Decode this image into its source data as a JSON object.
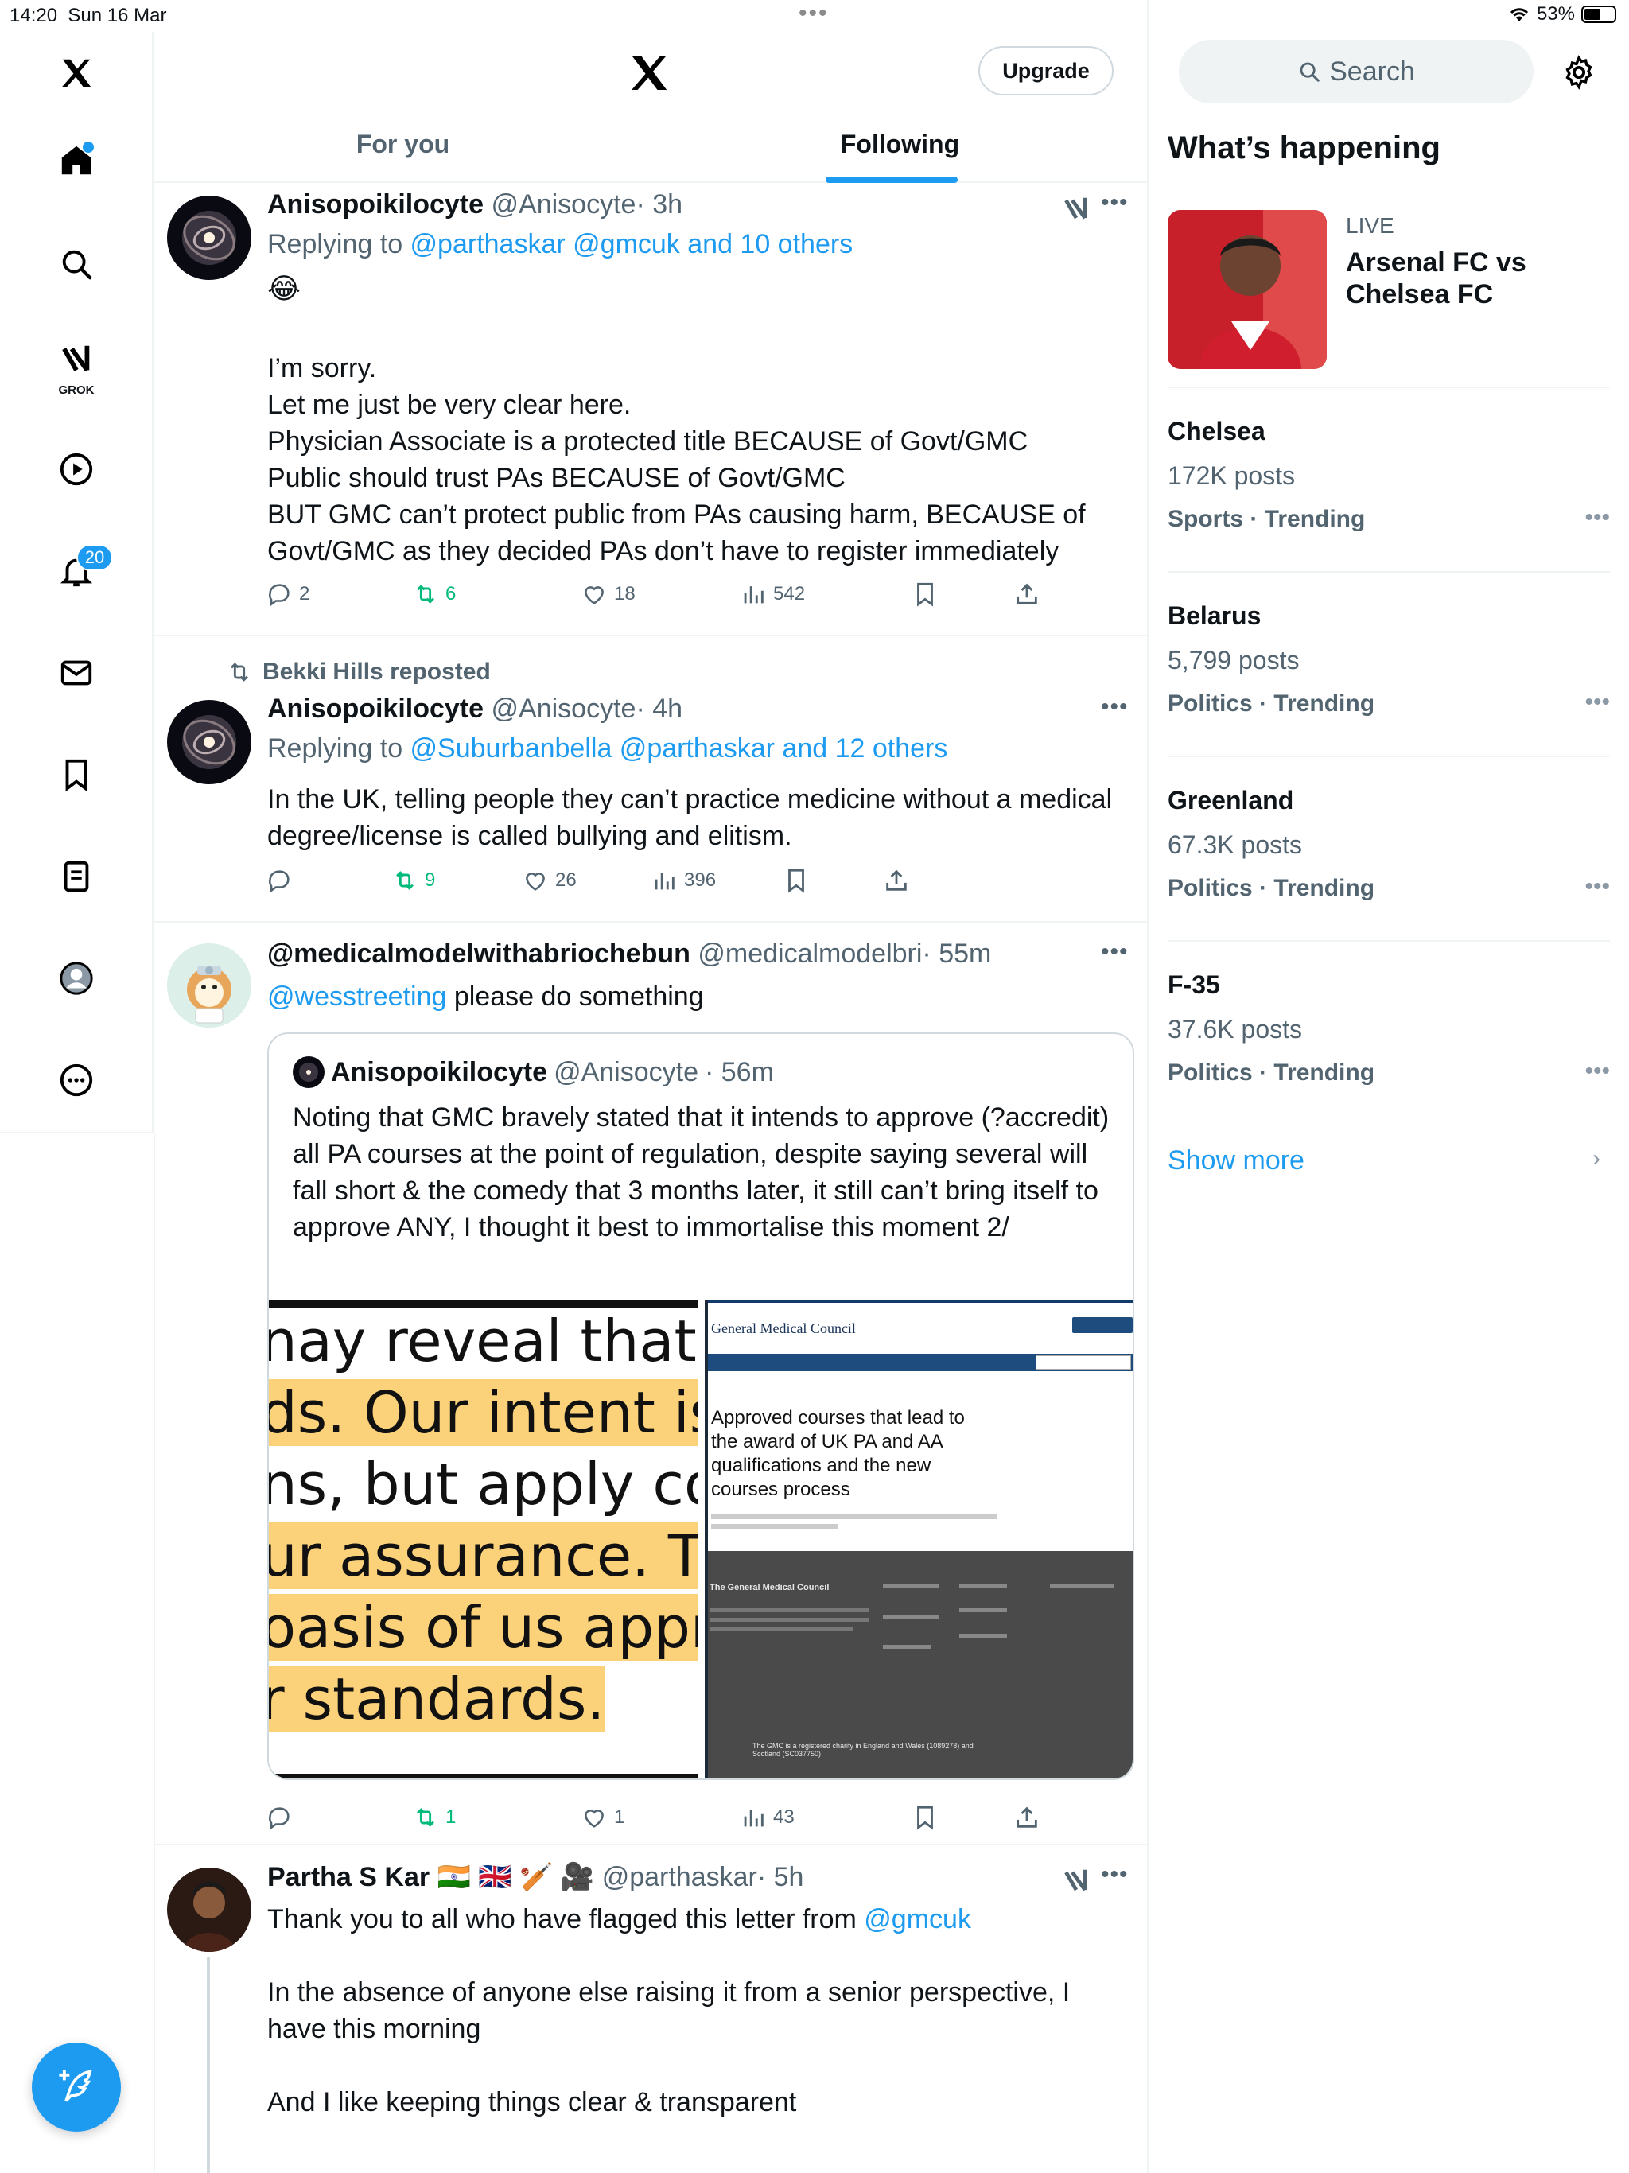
{
  "status_bar": {
    "time": "14:20",
    "date": "Sun 16 Mar",
    "battery": "53%"
  },
  "nav": {
    "grok_label": "GROK",
    "notifications_count": "20"
  },
  "header": {
    "upgrade_label": "Upgrade",
    "tabs": [
      {
        "label": "For you"
      },
      {
        "label": "Following"
      }
    ]
  },
  "tweets": [
    {
      "name": "Anisopoikilocyte",
      "handle": "@Anisocyte",
      "time": "· 3h",
      "reply_prefix": "Replying to ",
      "reply_targets": "@parthaskar @gmcuk and 10 others",
      "emoji": "😂",
      "text": "I’m sorry.\nLet me just be very clear here.\nPhysician Associate is a protected title BECAUSE of Govt/GMC\nPublic should trust PAs BECAUSE of Govt/GMC\nBUT GMC can’t protect public from PAs causing harm, BECAUSE of Govt/GMC as they decided PAs don’t have to register immediately",
      "replies": "2",
      "reposts": "6",
      "likes": "18",
      "views": "542"
    },
    {
      "repost_by": "Bekki Hills reposted",
      "name": "Anisopoikilocyte",
      "handle": "@Anisocyte",
      "time": "· 4h",
      "reply_prefix": "Replying to ",
      "reply_targets": "@Suburbanbella @parthaskar and 12 others",
      "text": "In the UK, telling people they can’t practice medicine without a medical degree/license is called bullying and elitism.",
      "replies": "",
      "reposts": "9",
      "likes": "26",
      "views": "396"
    },
    {
      "name": "@medicalmodelwithabriochebun",
      "handle": "@medicalmodelbri",
      "time": "· 55m",
      "mention": "@wesstreeting",
      "text": " please do something",
      "quote": {
        "name": "Anisopoikilocyte",
        "handle": "@Anisocyte",
        "time": "· 56m",
        "text": "Noting that GMC bravely stated that it intends to approve (?accredit) all PA courses at the point of regulation, despite saying several will fall short & the comedy that 3 months later, it still can’t bring itself to approve ANY, I thought it best to immortalise this moment 2/",
        "image_left_lines": [
          "nay reveal that PA",
          "ds. Our intent is to",
          "ns, but apply cond",
          "ur assurance. The",
          "oasis of us approv",
          "r standards."
        ],
        "gmc_site_title": "General Medical Council",
        "gmc_heading": "Approved courses that lead to the award of UK PA and AA qualifications and the new courses process",
        "gmc_footer_org": "The General Medical Council",
        "gmc_footer_charity": "The GMC is a registered charity in England and Wales (1089278) and Scotland (SC037750)"
      },
      "replies": "",
      "reposts": "1",
      "likes": "1",
      "views": "43"
    },
    {
      "name": "Partha S Kar",
      "flags": "🇮🇳 🇬🇧 🏏 🎥",
      "handle": "@parthaskar",
      "time": "· 5h",
      "text_prefix": "Thank you to all who have flagged this letter from ",
      "mention": "@gmcuk",
      "text": "In the absence of anyone else raising it from a senior perspective, I have this morning\n\nAnd I like keeping things clear & transparent"
    }
  ],
  "sidebar": {
    "search_placeholder": "Search",
    "whats_happening": "What’s happening",
    "live": {
      "tag": "LIVE",
      "title": "Arsenal FC vs Chelsea FC"
    },
    "trends": [
      {
        "name": "Chelsea",
        "posts": "172K posts",
        "category": "Sports · Trending"
      },
      {
        "name": "Belarus",
        "posts": "5,799 posts",
        "category": "Politics · Trending"
      },
      {
        "name": "Greenland",
        "posts": "67.3K posts",
        "category": "Politics · Trending"
      },
      {
        "name": "F-35",
        "posts": "37.6K posts",
        "category": "Politics · Trending"
      }
    ],
    "show_more": "Show more"
  },
  "colors": {
    "accent": "#1d9bf0",
    "repost": "#00ba7c",
    "secondary_text": "#536471",
    "divider": "#eff3f4"
  },
  "icons": [
    "x-logo-icon",
    "home-icon",
    "search-icon",
    "grok-icon",
    "video-icon",
    "bell-icon",
    "mail-icon",
    "bookmark-icon",
    "lists-icon",
    "profile-icon",
    "more-circle-icon",
    "compose-icon",
    "reply-icon",
    "repost-icon",
    "like-icon",
    "views-icon",
    "share-icon",
    "gear-icon",
    "chevron-right-icon",
    "wifi-icon",
    "battery-icon"
  ]
}
